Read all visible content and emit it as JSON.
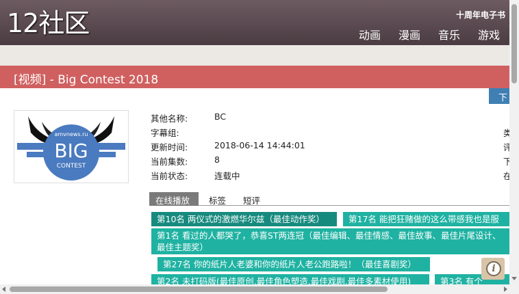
{
  "header": {
    "logo": "12社区",
    "tagline": "十周年电子书",
    "nav": [
      "动画",
      "漫画",
      "音乐",
      "游戏"
    ]
  },
  "page_title": "[视频] - Big Contest 2018",
  "download_label": "下",
  "cover": {
    "site_text": "amvnews.ru",
    "big_text": "BIG",
    "contest_text": "CONTEST"
  },
  "info": {
    "rows": [
      {
        "key": "其他名称:",
        "value": "BC"
      },
      {
        "key": "字幕组:",
        "value": ""
      },
      {
        "key": "更新时间:",
        "value": "2018-06-14 14:44:01"
      },
      {
        "key": "当前集数:",
        "value": "8"
      },
      {
        "key": "当前状态:",
        "value": "连载中"
      }
    ],
    "right_clipped": [
      "类",
      "评",
      "下",
      "在"
    ]
  },
  "tabs": [
    "在线播放",
    "标签",
    "短评"
  ],
  "episodes": [
    "第10名 两仪式的激燃华尔兹（最佳动作奖）",
    "第17名 能把狂赌做的这么带感我也是服",
    "第1名 看过的人都哭了，恭喜ST两连冠（最佳编辑、最佳情感、最佳故事、最佳片尾设计、最佳主题奖）",
    "第27名 你的纸片人老婆和你的纸片人老公跑路啦！（最佳喜剧奖）",
    "第2名 未打码版(最佳原创,最佳角色塑造,最佳戏剧,最佳多素材使用)",
    "第3名 有个"
  ],
  "info_button": "i"
}
